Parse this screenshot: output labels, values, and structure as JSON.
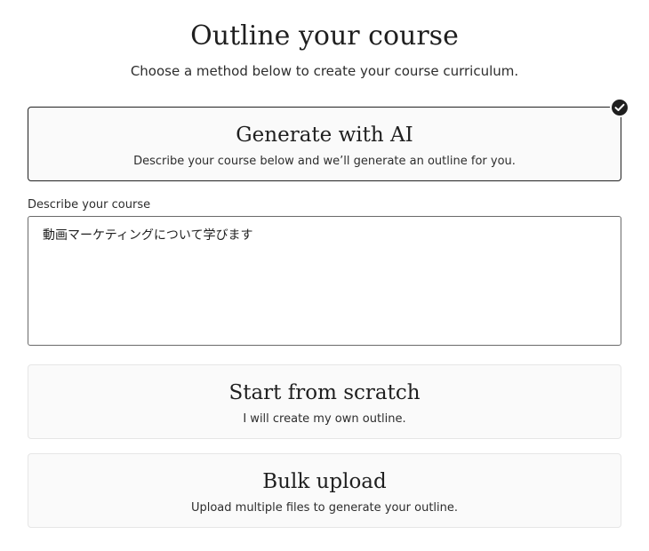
{
  "header": {
    "title": "Outline your course",
    "subtitle": "Choose a method below to create your course curriculum."
  },
  "options": [
    {
      "id": "ai",
      "title": "Generate with AI",
      "description": "Describe your course below and we’ll generate an outline for you.",
      "selected": true
    },
    {
      "id": "scratch",
      "title": "Start from scratch",
      "description": "I will create my own outline.",
      "selected": false
    },
    {
      "id": "bulk",
      "title": "Bulk upload",
      "description": "Upload multiple files to generate your outline.",
      "selected": false
    }
  ],
  "describe": {
    "label": "Describe your course",
    "value": "動画マーケティングについて学びます"
  },
  "icons": {
    "selected_badge": "checkmark-circle-icon"
  },
  "colors": {
    "selected_border": "#222222",
    "unselected_border": "#e6e6e6",
    "card_background": "#fafafa",
    "badge": "#1f1f1f"
  }
}
